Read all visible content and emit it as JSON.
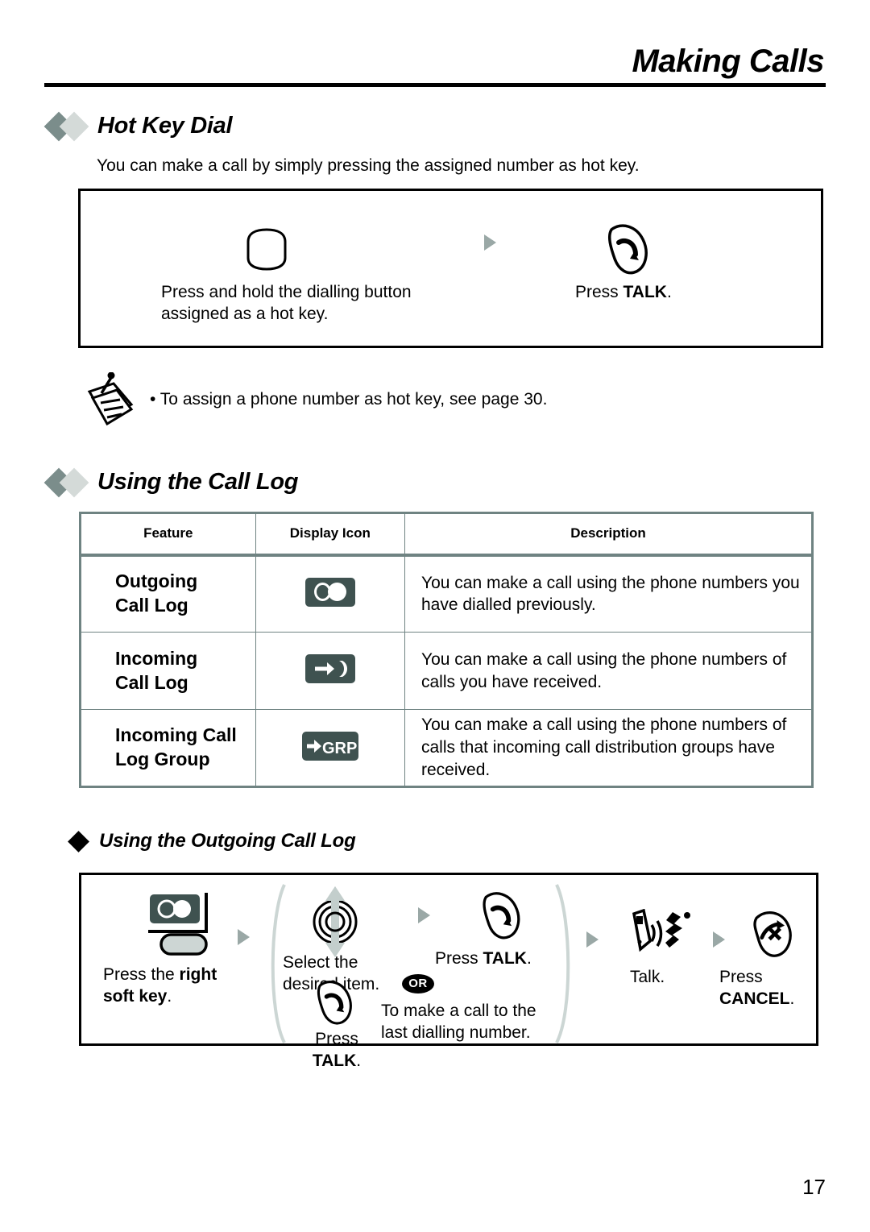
{
  "page": {
    "title": "Making Calls",
    "number": "17"
  },
  "hotkey": {
    "heading": "Hot Key Dial",
    "intro": "You can make a call by simply pressing the assigned number as hot key.",
    "steps": [
      {
        "icon": "dialling-button-icon",
        "caption_line1": "Press and hold the dialling button",
        "caption_line2": "assigned as a hot key."
      },
      {
        "icon": "talk-key-icon",
        "caption_pre": "Press ",
        "caption_bold": "TALK",
        "caption_post": "."
      }
    ],
    "note": "• To assign a phone number as hot key, see page 30.",
    "note_icon": "note-pad-icon"
  },
  "calllog": {
    "heading": "Using the Call Log",
    "table": {
      "headers": [
        "Feature",
        "Display Icon",
        "Description"
      ],
      "rows": [
        {
          "feature_line1": "Outgoing",
          "feature_line2": "Call Log",
          "icon": "outgoing-call-log-icon",
          "description": "You can make a call using the phone numbers you have dialled previously."
        },
        {
          "feature_line1": "Incoming",
          "feature_line2": "Call Log",
          "icon": "incoming-call-log-icon",
          "description": "You can make a call using the phone numbers of calls you have received."
        },
        {
          "feature_line1": "Incoming Call",
          "feature_line2": "Log Group",
          "icon": "incoming-call-log-group-icon",
          "description": "You can make a call using the phone numbers of calls that incoming call distribution groups have received."
        }
      ]
    }
  },
  "outgoing": {
    "heading": "Using the Outgoing Call Log",
    "step1": {
      "icon": "right-soft-key-icon",
      "caption_pre": "Press the ",
      "caption_bold": "right",
      "caption_line2_bold": "soft key",
      "caption_line2_post": "."
    },
    "step2a": {
      "icon": "navigator-updown-icon",
      "line1": "Select the",
      "line2": "desired item."
    },
    "step2b": {
      "icon": "talk-key-icon",
      "pre": "Press ",
      "bold": "TALK",
      "post": "."
    },
    "step2c": {
      "icon": "talk-key-icon",
      "line1": "Press",
      "line2_bold": "TALK",
      "line2_post": "."
    },
    "or_label": "OR",
    "step2d": {
      "line1": "To make a call to the",
      "line2": "last dialling number."
    },
    "step3": {
      "icon": "talking-handset-icon",
      "caption": "Talk."
    },
    "step4": {
      "icon": "cancel-key-icon",
      "line1": "Press",
      "line2_bold": "CANCEL",
      "line2_post": "."
    }
  },
  "colors": {
    "diamond_dark": "#7b8d8b",
    "diamond_light": "#d4dad8",
    "table_border": "#6f8382",
    "icon_bg": "#3f5250",
    "arrow_gray": "#9aa8a6"
  }
}
